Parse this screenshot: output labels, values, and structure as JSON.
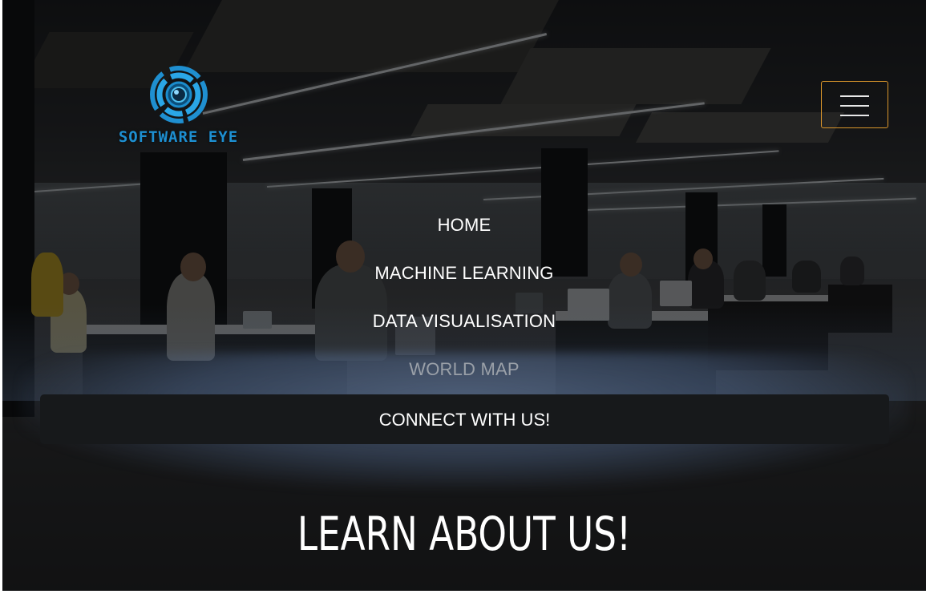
{
  "brand": {
    "name": "SOFTWARE EYE",
    "logo_icon": "eye-lens-icon",
    "color": "#1d8fd1"
  },
  "header": {
    "menu_toggle_icon": "hamburger-menu-icon",
    "menu_toggle_border_color": "#d9952b"
  },
  "nav": {
    "items": [
      {
        "label": "HOME",
        "state": "normal"
      },
      {
        "label": "MACHINE LEARNING",
        "state": "normal"
      },
      {
        "label": "DATA VISUALISATION",
        "state": "normal"
      },
      {
        "label": "WORLD MAP",
        "state": "dimmed"
      },
      {
        "label": "CONNECT WITH US!",
        "state": "highlighted"
      }
    ]
  },
  "hero": {
    "headline": "LEARN ABOUT US!",
    "background_description_color": "#15181d"
  }
}
